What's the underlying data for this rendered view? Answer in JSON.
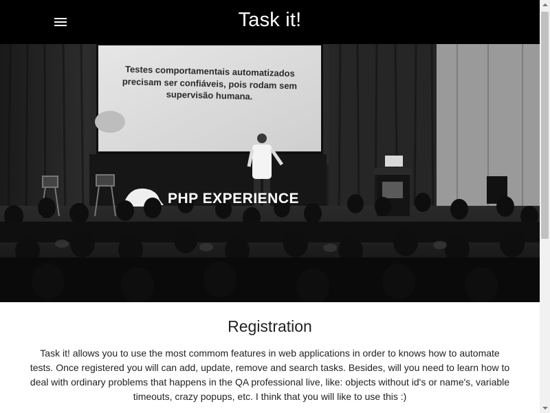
{
  "header": {
    "menu_icon": "hamburger-menu-icon",
    "title": "Task it!"
  },
  "hero": {
    "slide_lines": [
      "Testes comportamentais automatizados",
      "precisam ser confiáveis, pois rodam sem",
      "supervisão humana."
    ],
    "stage_sign": "PHP EXPERIENCE"
  },
  "registration": {
    "heading": "Registration",
    "lines": [
      "Task it! allows you to use the most commom features in web applications in order to knows how to automate",
      "tests. Once registered you will can add, update, remove and search tasks. Besides, will you need to learn how to",
      "deal with ordinary problems that happens in the QA professional live, like: objects without id's or name's, variable",
      "timeouts, crazy popups, etc. I think that you will like to use this :)"
    ]
  },
  "colors": {
    "navbar_bg": "#000000",
    "navbar_text": "#ffffff",
    "body_text": "#222222"
  }
}
